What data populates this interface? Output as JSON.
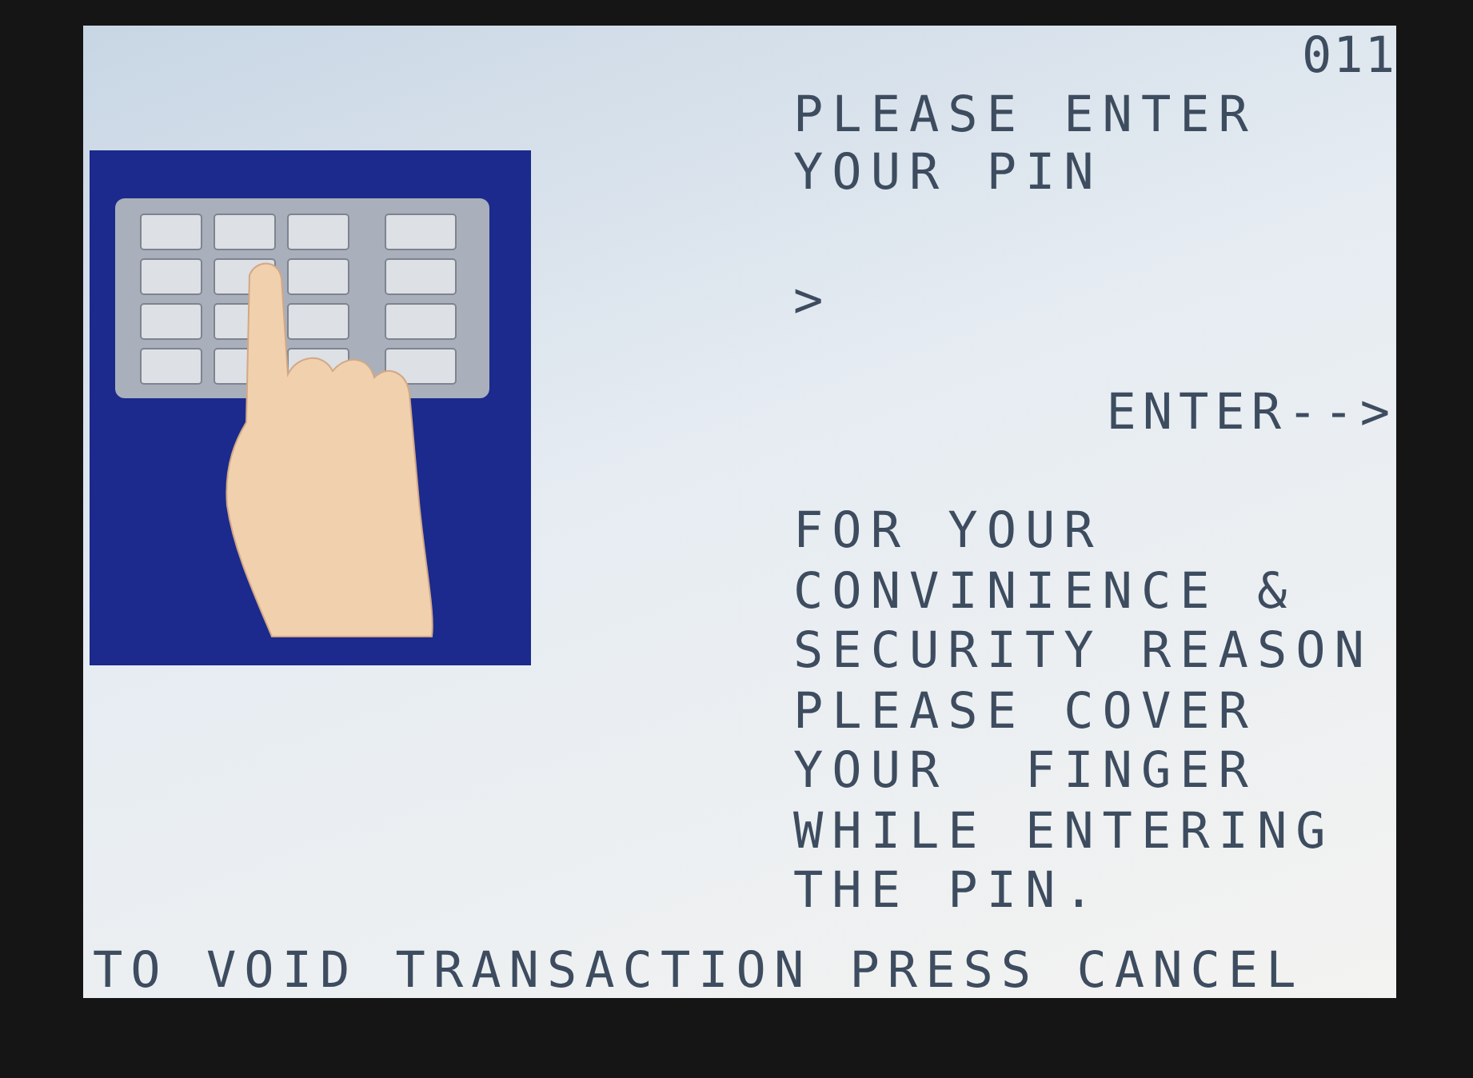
{
  "screen_code": "011",
  "title_lines": [
    "PLEASE ENTER",
    "YOUR PIN"
  ],
  "pin_prompt": ">",
  "enter_hint": "ENTER-->",
  "notice_lines": [
    "FOR YOUR",
    "CONVINIENCE &",
    "SECURITY REASON",
    "PLEASE COVER",
    "YOUR  FINGER",
    "WHILE ENTERING",
    "THE PIN."
  ],
  "footer": "TO VOID TRANSACTION PRESS CANCEL"
}
